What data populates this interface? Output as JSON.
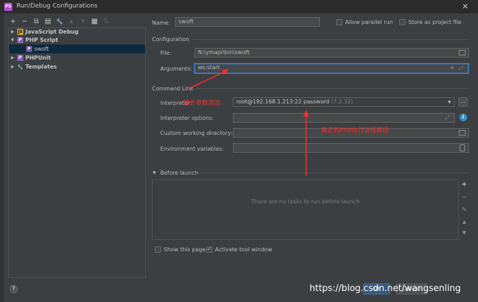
{
  "window": {
    "title": "Run/Debug Configurations",
    "app_icon": "PS",
    "close_glyph": "✕"
  },
  "toolbar": {
    "glyphs": [
      "+",
      "−",
      "⧉",
      "▤",
      "🔧",
      "▲",
      "▼",
      "▦",
      "⇅"
    ]
  },
  "tree": {
    "items": [
      {
        "label": "JavaScript Debug",
        "arrow": "▶",
        "icon_letter": "JS"
      },
      {
        "label": "PHP Script",
        "arrow": "▼",
        "icon_letter": "P"
      },
      {
        "label": "swoft",
        "icon_letter": "P"
      },
      {
        "label": "PHPUnit",
        "arrow": "▶",
        "icon_letter": "P"
      },
      {
        "label": "Templates",
        "arrow": "▶",
        "icon_letter": "🔧"
      }
    ]
  },
  "form": {
    "name_label": "Name:",
    "name_value": "swoft",
    "allow_parallel": "Allow parallel run",
    "store_project": "Store as project file",
    "configuration_header": "Configuration",
    "file_label": "File:",
    "file_value": "N:\\ymapi\\bin\\swoft",
    "arguments_label": "Arguments:",
    "arguments_value": "ws:start",
    "command_line_header": "Command Line",
    "interpreter_label": "Interpreter:",
    "interpreter_value": "root@192.168.1.213:22 password",
    "interpreter_version": "(7.2.32)",
    "interpreter_options_label": "Interpreter options:",
    "working_dir_label": "Custom working directory:",
    "env_vars_label": "Environment variables:",
    "ellipsis": "...",
    "info_glyph": "i",
    "expand_glyph": "⤢",
    "plus_glyph": "+",
    "dropdown_glyph": "▼"
  },
  "before_launch": {
    "header": "Before launch",
    "toggle_glyph": "▼",
    "empty_text": "There are no tasks to run before launch",
    "side_glyphs": [
      "+",
      "−",
      "✎",
      "▲",
      "▼"
    ]
  },
  "footer": {
    "show_page": "Show this page",
    "activate_tool_window": "Activate tool window",
    "help": "?",
    "ok": "OK",
    "cancel": "Cancel"
  },
  "annotations": {
    "extra_params": "额外参数添加",
    "remote_path": "真正的PHP执行远程路径"
  },
  "watermark": "https://blog.csdn.net/wangsenling",
  "colors": {
    "accent": "#3d76bb",
    "annotation": "#ff2a2a",
    "selected": "#0d293e",
    "background": "#3c3f41"
  }
}
